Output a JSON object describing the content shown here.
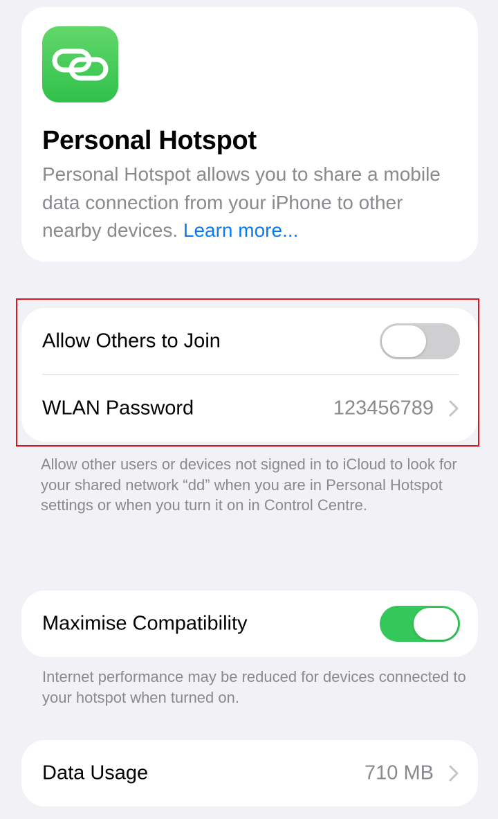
{
  "intro": {
    "title": "Personal Hotspot",
    "description": "Personal Hotspot allows you to share a mobile data connection from your iPhone to other nearby devices.",
    "learn_more": "Learn more...",
    "icon": "personal-hotspot-link-icon",
    "icon_color": "#34c759"
  },
  "join_section": {
    "allow_others_label": "Allow Others to Join",
    "allow_others_on": false,
    "password_label": "WLAN Password",
    "password_value": "123456789",
    "footnote": "Allow other users or devices not signed in to iCloud to look for your shared network “dd” when you are in Personal Hotspot settings or when you turn it on in Control Centre."
  },
  "compat_section": {
    "label": "Maximise Compatibility",
    "on": true,
    "footnote": "Internet performance may be reduced for devices connected to your hotspot when turned on."
  },
  "usage_section": {
    "label": "Data Usage",
    "value": "710 MB"
  },
  "colors": {
    "background": "#f2f1f6",
    "accent_link": "#0a7bf6",
    "toggle_on": "#34c759",
    "toggle_off": "#cfcfd2",
    "highlight": "#e0141b"
  }
}
